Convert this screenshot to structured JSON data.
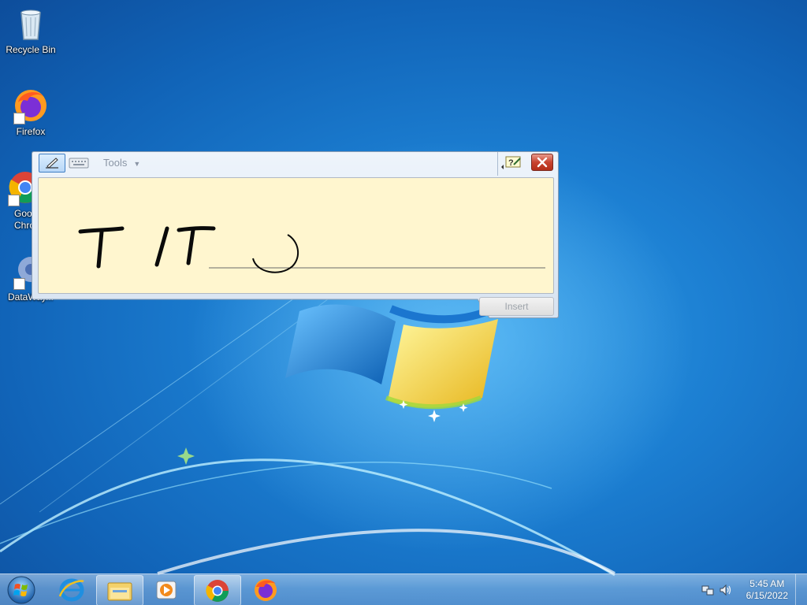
{
  "desktop": {
    "icons": [
      {
        "label": "Recycle Bin"
      },
      {
        "label": "Firefox"
      },
      {
        "label": "Google Chrome",
        "visible_label": "Goo Chro"
      },
      {
        "label": "DataWay..."
      }
    ]
  },
  "tip": {
    "tools_label": "Tools",
    "insert_label": "Insert",
    "handwritten_ink": "T IT"
  },
  "taskbar": {
    "pinned": [
      {
        "name": "internet-explorer-icon"
      },
      {
        "name": "file-explorer-icon"
      },
      {
        "name": "media-player-icon"
      },
      {
        "name": "chrome-icon"
      },
      {
        "name": "firefox-icon"
      }
    ],
    "clock": {
      "time": "5:45 AM",
      "date": "6/15/2022"
    }
  },
  "colors": {
    "desktop_bg": "#1c7fd2",
    "writing_pad": "#fff6cf",
    "close_button": "#c8432f"
  }
}
